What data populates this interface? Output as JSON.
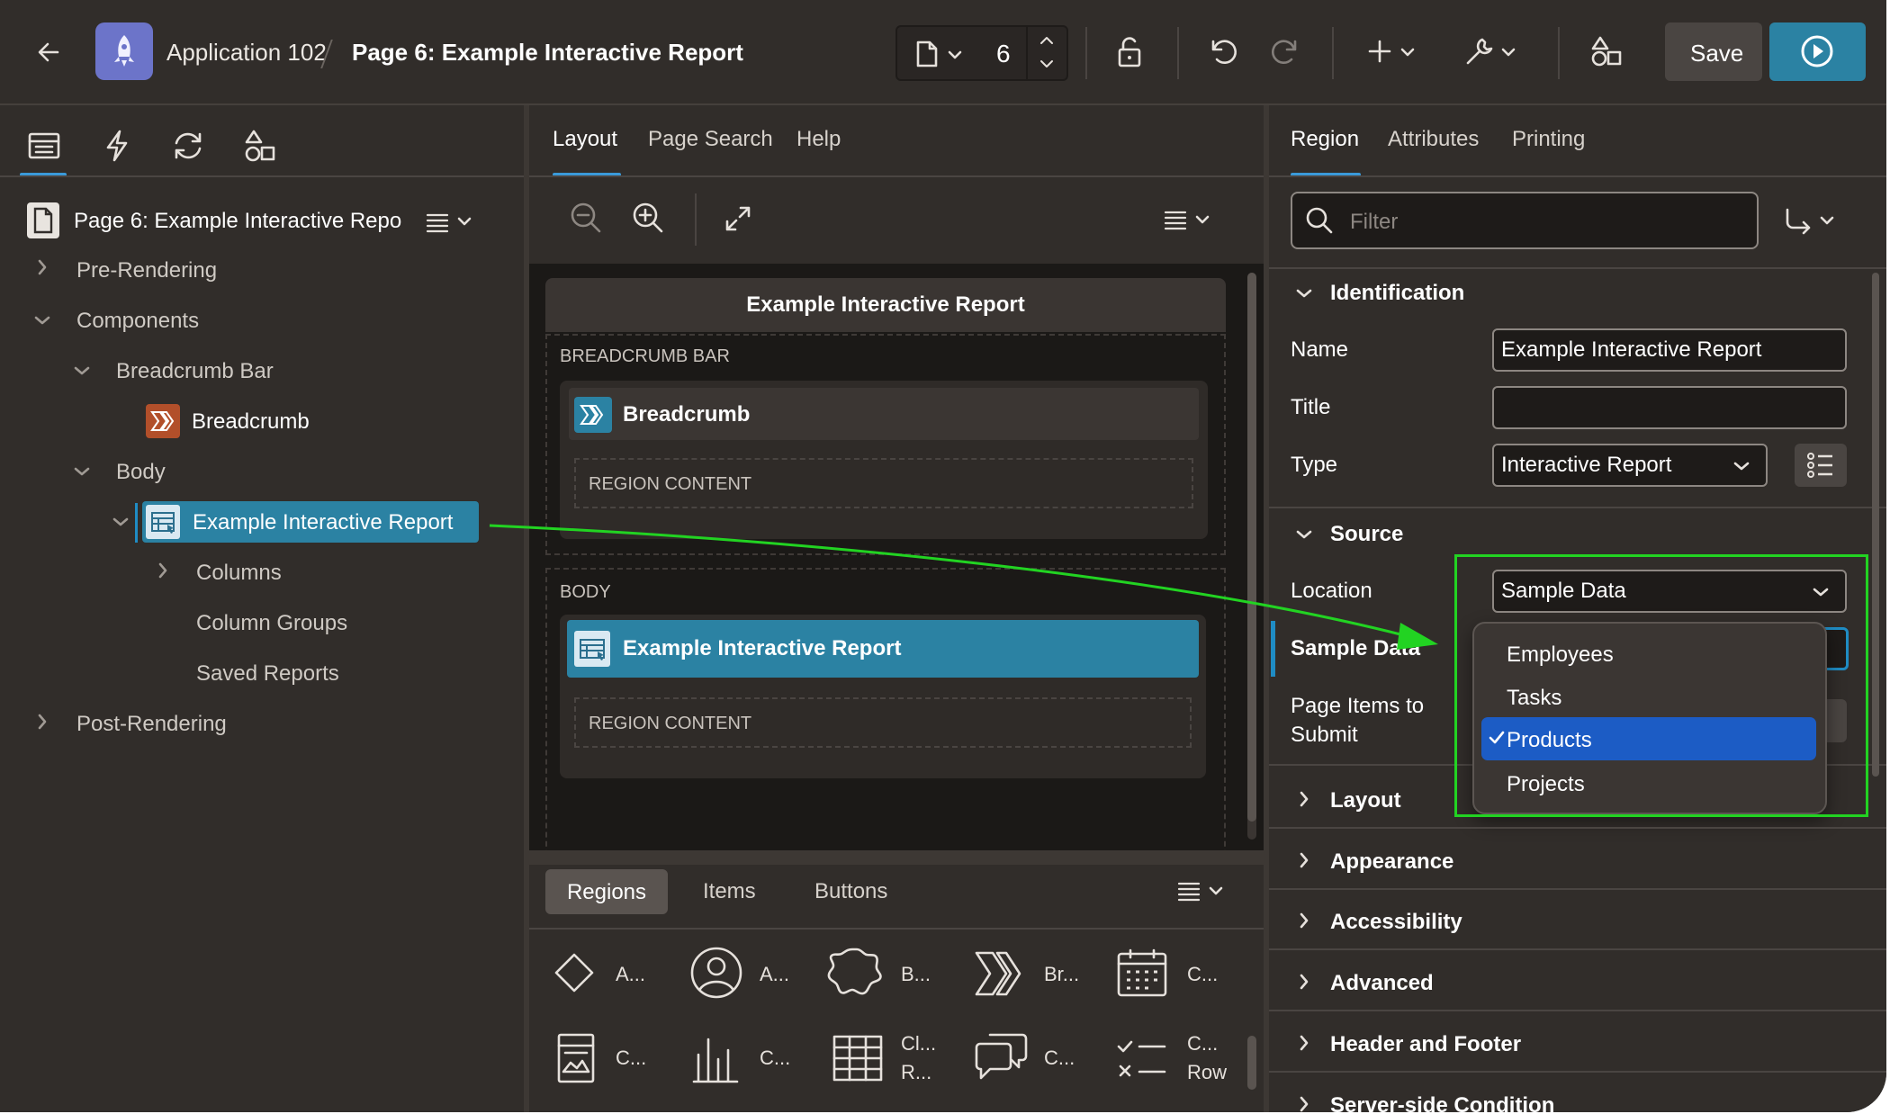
{
  "header": {
    "app_name": "Application 102",
    "page_title": "Page 6: Example Interactive Report",
    "page_number": "6",
    "save_label": "Save"
  },
  "left_panel": {
    "root_label": "Page 6: Example Interactive Repoı",
    "tree": {
      "pre_rendering": "Pre-Rendering",
      "components": "Components",
      "breadcrumb_bar": "Breadcrumb Bar",
      "breadcrumb": "Breadcrumb",
      "body": "Body",
      "example_report": "Example Interactive Report",
      "columns": "Columns",
      "column_groups": "Column Groups",
      "saved_reports": "Saved Reports",
      "post_rendering": "Post-Rendering"
    }
  },
  "center_panel": {
    "tabs": [
      "Layout",
      "Page Search",
      "Help"
    ],
    "canvas": {
      "page_header": "Example Interactive Report",
      "breadcrumb_bar_label": "BREADCRUMB BAR",
      "breadcrumb_region": "Breadcrumb",
      "region_content": "REGION CONTENT",
      "body_label": "BODY",
      "report_region": "Example Interactive Report"
    },
    "gallery": {
      "tabs": [
        "Regions",
        "Items",
        "Buttons"
      ],
      "row1": [
        "A...",
        "A...",
        "B...",
        "Br...",
        "C..."
      ],
      "row2": [
        "C...",
        "C...",
        "Cl...",
        "R...",
        "C...",
        "C...",
        "Row"
      ]
    }
  },
  "right_panel": {
    "tabs": [
      "Region",
      "Attributes",
      "Printing"
    ],
    "filter_placeholder": "Filter",
    "identification": {
      "heading": "Identification",
      "name_label": "Name",
      "name_value": "Example Interactive Report",
      "title_label": "Title",
      "title_value": "",
      "type_label": "Type",
      "type_value": "Interactive Report"
    },
    "source": {
      "heading": "Source",
      "location_label": "Location",
      "location_value": "Sample Data",
      "sample_data_label": "Sample Data",
      "page_items_label_1": "Page Items to",
      "page_items_label_2": "Submit"
    },
    "dropdown_options": [
      "Employees",
      "Tasks",
      "Products",
      "Projects"
    ],
    "dropdown_selected": "Products",
    "collapsed_groups": [
      "Layout",
      "Appearance",
      "Accessibility",
      "Advanced",
      "Header and Footer",
      "Server-side Condition"
    ]
  },
  "colors": {
    "background": "#312d2a",
    "accent": "#2b82a3",
    "selection_blue": "#1c5cc5",
    "annotation_green": "#22d322"
  }
}
